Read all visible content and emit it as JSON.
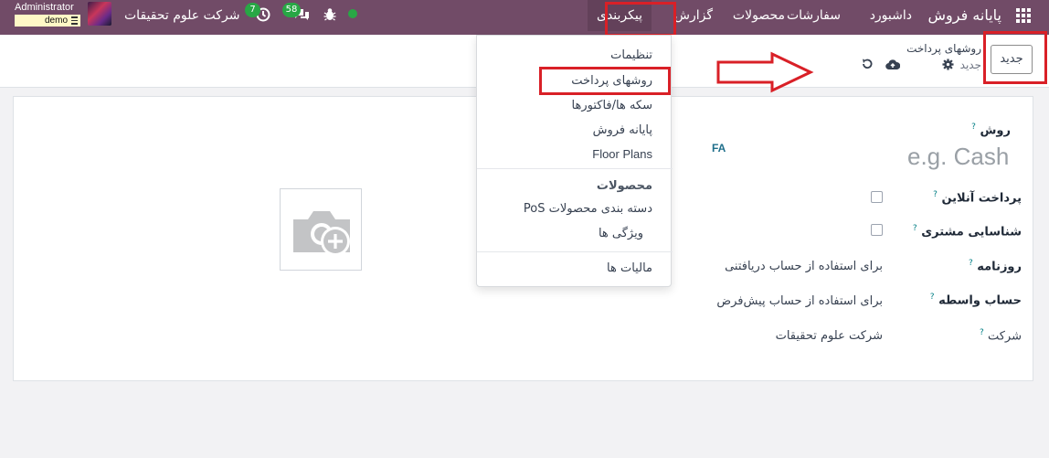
{
  "navbar": {
    "app_name": "پایانه فروش",
    "menus": [
      "داشبورد",
      "سفارشات",
      "محصولات",
      "گزارش",
      "پیکربندی"
    ],
    "company": "شرکت علوم تحقیقات",
    "messages_count": "58",
    "activities_count": "7",
    "user_name": "Administrator",
    "db_name": "demo",
    "icons": [
      "apps-grid-icon",
      "chat-icon",
      "clock-icon",
      "bug-icon",
      "status-dot-icon"
    ],
    "status_color": "#28a745",
    "bar_color": "#714b67"
  },
  "control_panel": {
    "new_button": "جدید",
    "breadcrumb": "روشهای پرداخت",
    "record_name": "جدید"
  },
  "dropdown": {
    "items_top": [
      "تنظیمات",
      "روشهای پرداخت",
      "سکه ها/فاکتورها",
      "پایانه فروش",
      "Floor Plans"
    ],
    "section_header": "محصولات",
    "items_products": [
      "دسته بندی محصولات PoS",
      "ویژگی ها"
    ],
    "items_bottom": [
      "مالیات ها"
    ]
  },
  "form": {
    "method_label": "روش",
    "name_placeholder": "e.g. Cash",
    "lang": "FA",
    "online_payment_label": "پرداخت آنلاین",
    "identify_customer_label": "شناسایی مشتری",
    "journal_label": "روزنامه",
    "journal_value": "برای استفاده از حساب دریافتنی",
    "intermediary_label": "حساب واسطه",
    "intermediary_value": "برای استفاده از حساب پیش‌فرض",
    "company_label": "شرکت",
    "company_value": "شرکت علوم تحقیقات",
    "help_mark": "?"
  },
  "annotations": {
    "highlight_color": "#d92027"
  }
}
